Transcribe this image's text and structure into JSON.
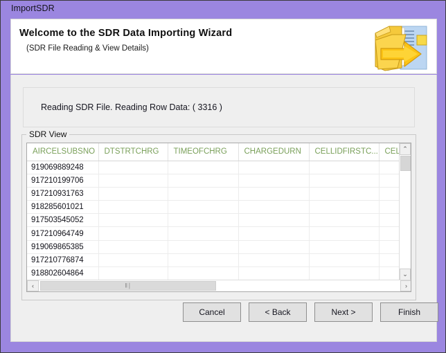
{
  "window": {
    "title": "ImportSDR",
    "titlebar_color": "#9b86e0"
  },
  "header": {
    "title": "Welcome to the SDR Data Importing Wizard",
    "subtitle": "(SDR File Reading & View Details)",
    "icon": "import-folder-arrow-icon"
  },
  "status": {
    "text": "Reading SDR File.   Reading Row Data: ( 3316 )",
    "row_count": "3316"
  },
  "groupbox": {
    "label": "SDR View"
  },
  "grid": {
    "columns": [
      "AIRCELSUBSNO",
      "DTSTRTCHRG",
      "TIMEOFCHRG",
      "CHARGEDURN",
      "CELLIDFIRSTC...",
      "CELLIDLAS"
    ],
    "header_color": "#7aa05a",
    "rows": [
      [
        "919069889248",
        "",
        "",
        "",
        "",
        ""
      ],
      [
        "917210199706",
        "",
        "",
        "",
        "",
        ""
      ],
      [
        "917210931763",
        "",
        "",
        "",
        "",
        ""
      ],
      [
        "918285601021",
        "",
        "",
        "",
        "",
        ""
      ],
      [
        "917503545052",
        "",
        "",
        "",
        "",
        ""
      ],
      [
        "917210964749",
        "",
        "",
        "",
        "",
        ""
      ],
      [
        "919069865385",
        "",
        "",
        "",
        "",
        ""
      ],
      [
        "917210776874",
        "",
        "",
        "",
        "",
        ""
      ],
      [
        "918802604864",
        "",
        "",
        "",
        "",
        ""
      ]
    ],
    "vscroll": {
      "up_glyph": "⌃",
      "down_glyph": "⌄"
    },
    "hscroll": {
      "left_glyph": "‹",
      "right_glyph": "›",
      "grip_glyph": "‖∣"
    }
  },
  "buttons": {
    "cancel": "Cancel",
    "back": "< Back",
    "next": "Next >",
    "finish": "Finish"
  }
}
